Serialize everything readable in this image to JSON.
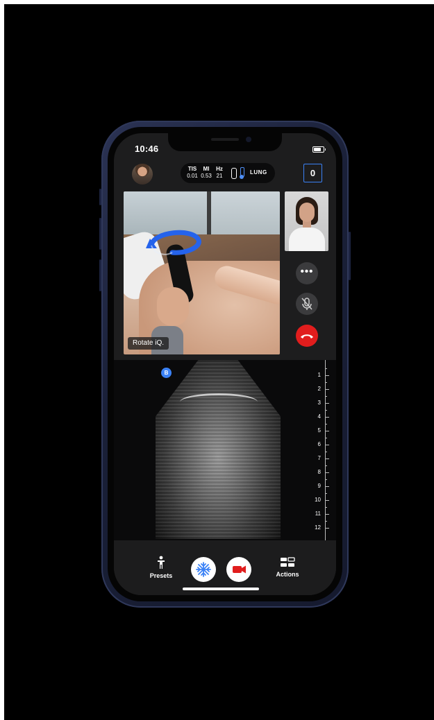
{
  "status_bar": {
    "time": "10:46"
  },
  "header": {
    "stats": [
      {
        "label": "TIS",
        "value": "0.01"
      },
      {
        "label": "MI",
        "value": "0.53"
      },
      {
        "label": "Hz",
        "value": "21"
      }
    ],
    "preset": "LUNG",
    "counter": "0"
  },
  "video": {
    "hint": "Rotate iQ."
  },
  "call_controls": {
    "more": "•••"
  },
  "ultrasound": {
    "mode_badge": "B",
    "depth_labels": [
      "1",
      "2",
      "3",
      "4",
      "5",
      "6",
      "7",
      "8",
      "9",
      "10",
      "11",
      "12"
    ]
  },
  "bottom_nav": {
    "presets_label": "Presets",
    "actions_label": "Actions"
  },
  "colors": {
    "accent": "#3b82f6",
    "end_call": "#e11d1d",
    "record": "#e11d1d"
  }
}
